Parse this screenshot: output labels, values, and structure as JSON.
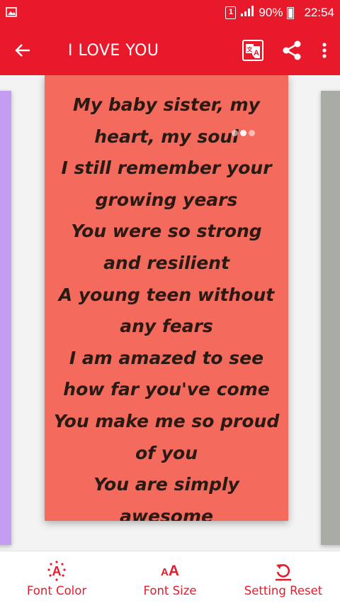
{
  "status_bar": {
    "sim_slot": "1",
    "battery": "90%",
    "time": "22:54"
  },
  "app_bar": {
    "title": "I LOVE YOU",
    "icons": [
      "back-arrow-icon",
      "translate-icon",
      "share-icon",
      "more-vert-icon"
    ]
  },
  "quote": {
    "text": "My baby sister, my\nheart, my soul\nI still remember your\ngrowing years\nYou were so strong\nand resilient\nA young teen without\nany fears\nI am amazed to see\nhow far you've come\nYou make me so proud\nof you\nYou are simply\nawesome",
    "card_color": "#f46a5c",
    "left_card_color": "#c39bf0",
    "right_card_color": "#a9aba7"
  },
  "bottom_bar": {
    "font_color_label": "Font Color",
    "font_size_label": "Font Size",
    "reset_label": "Setting Reset"
  },
  "colors": {
    "primary": "#e8192a",
    "text_dark": "#2a1a14",
    "background": "#f3f3f3"
  }
}
